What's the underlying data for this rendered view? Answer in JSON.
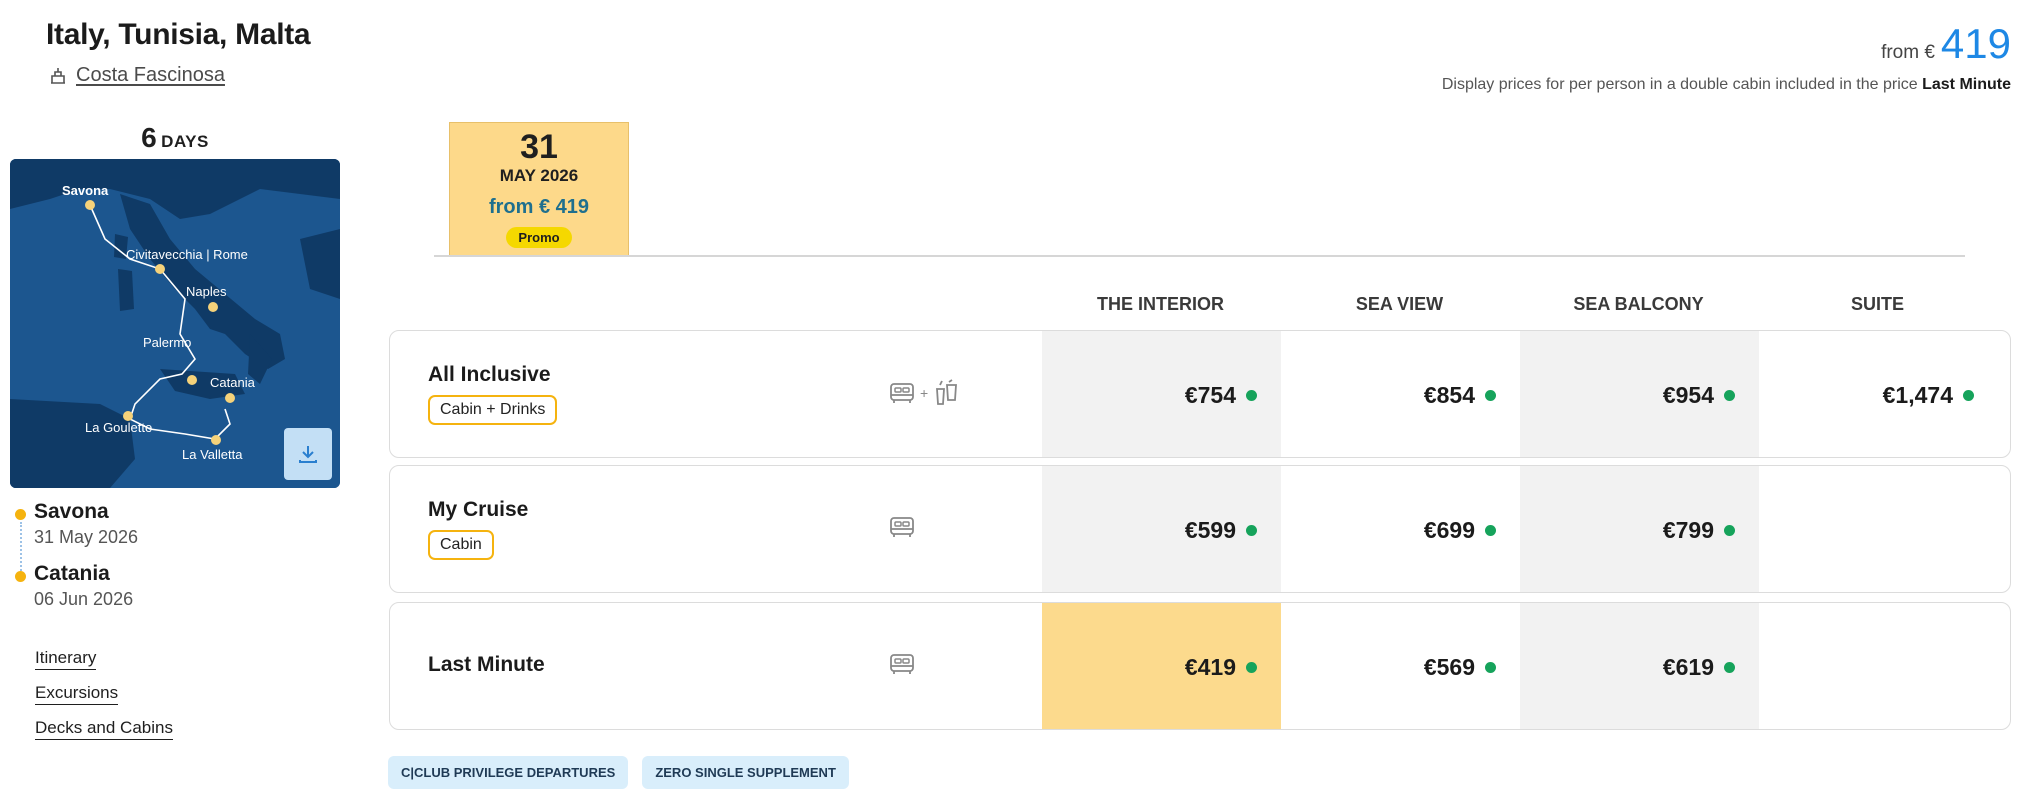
{
  "header": {
    "title": "Italy, Tunisia, Malta",
    "ship": "Costa Fascinosa",
    "from_label": "from €",
    "from_value": "419",
    "price_note": "Display prices for per person in a double cabin included in the price",
    "price_note_bold": "Last Minute"
  },
  "sidebar": {
    "days_num": "6",
    "days_label": "DAYS",
    "map_ports": [
      "Savona",
      "Civitavecchia | Rome",
      "Naples",
      "Palermo",
      "Catania",
      "La Goulette",
      "La Valletta"
    ],
    "route": [
      {
        "city": "Savona",
        "date": "31 May 2026"
      },
      {
        "city": "Catania",
        "date": "06 Jun 2026"
      }
    ],
    "links": [
      "Itinerary",
      "Excursions",
      "Decks and Cabins"
    ]
  },
  "date_tab": {
    "day": "31",
    "month": "MAY 2026",
    "from": "from € 419",
    "badge": "Promo"
  },
  "columns": [
    "THE INTERIOR",
    "SEA VIEW",
    "SEA BALCONY",
    "SUITE"
  ],
  "fares": [
    {
      "name": "All Inclusive",
      "badge": "Cabin + Drinks",
      "icons": [
        "bed-icon",
        "drinks-icon"
      ],
      "prices": [
        "€754",
        "€854",
        "€954",
        "€1,474"
      ]
    },
    {
      "name": "My Cruise",
      "badge": "Cabin",
      "icons": [
        "bed-icon"
      ],
      "prices": [
        "€599",
        "€699",
        "€799",
        ""
      ]
    },
    {
      "name": "Last Minute",
      "badge": "",
      "icons": [
        "bed-icon"
      ],
      "prices": [
        "€419",
        "€569",
        "€619",
        ""
      ]
    }
  ],
  "tags": [
    "C|CLUB PRIVILEGE DEPARTURES",
    "ZERO SINGLE SUPPLEMENT"
  ],
  "colors": {
    "accent_blue": "#1e88e5",
    "promo_yellow": "#fcda8d",
    "available_green": "#16a35b",
    "port_yellow": "#f5b30f",
    "map_sea": "#1a4f86"
  }
}
